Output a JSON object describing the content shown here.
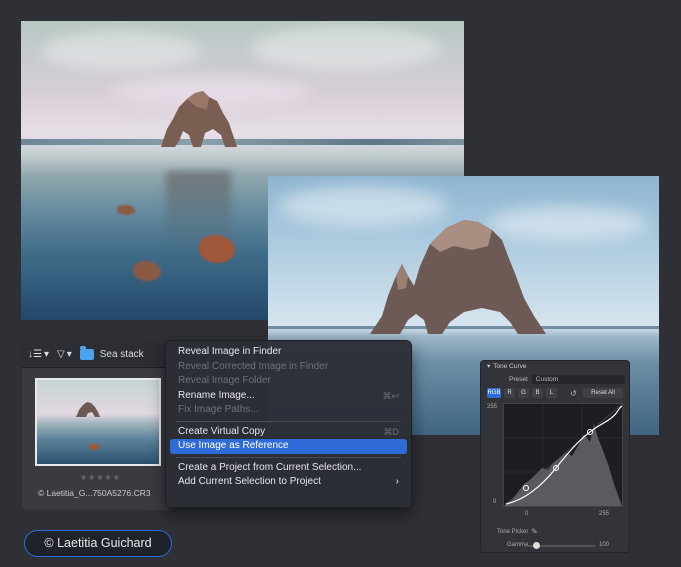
{
  "toolbar": {
    "folder_name": "Sea stack"
  },
  "thumbnail": {
    "stars": "★★★★★",
    "filename": "© Laetitia_G...750A5276.CR3"
  },
  "context_menu": {
    "items": [
      {
        "label": "Reveal Image in Finder",
        "enabled": true
      },
      {
        "label": "Reveal Corrected Image in Finder",
        "enabled": false
      },
      {
        "label": "Reveal Image Folder",
        "enabled": false
      },
      {
        "label": "Rename Image...",
        "enabled": true,
        "shortcut": "⌘↩"
      },
      {
        "label": "Fix Image Paths...",
        "enabled": false
      },
      {
        "label": "Create Virtual Copy",
        "enabled": true,
        "shortcut": "⌘D"
      },
      {
        "label": "Use Image as Reference",
        "enabled": true,
        "highlighted": true
      },
      {
        "label": "Create a Project from Current Selection...",
        "enabled": true
      },
      {
        "label": "Add Current Selection to Project",
        "enabled": true,
        "submenu": true
      }
    ]
  },
  "tone_curve": {
    "title": "Tone Curve",
    "preset_label": "Preset",
    "preset_value": "Custom",
    "channels": [
      "RGB",
      "R",
      "G",
      "B",
      "L"
    ],
    "active_channel": "RGB",
    "reset_label": "Reset All",
    "y_max": "255",
    "y_min": "0",
    "x_min": "0",
    "x_max": "255",
    "tone_picker_label": "Tone Picker",
    "gamma_label": "Gamma",
    "gamma_value": "100"
  },
  "credit": "© Laetitia Guichard"
}
